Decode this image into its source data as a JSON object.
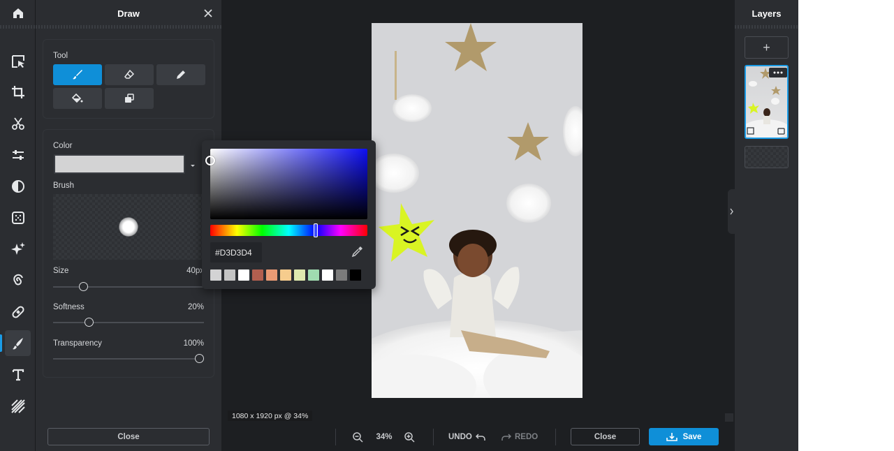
{
  "panel": {
    "title": "Draw",
    "close_label": "Close"
  },
  "tool": {
    "label": "Tool",
    "buttons": [
      {
        "name": "brush",
        "selected": true
      },
      {
        "name": "eraser"
      },
      {
        "name": "pencil"
      },
      {
        "name": "fill"
      },
      {
        "name": "clone"
      }
    ]
  },
  "color": {
    "label": "Color",
    "value": "#D3D3D4"
  },
  "brush": {
    "label": "Brush",
    "size": {
      "label": "Size",
      "value": "40px",
      "fraction": 0.18
    },
    "softness": {
      "label": "Softness",
      "value": "20%",
      "fraction": 0.22
    },
    "transparency": {
      "label": "Transparency",
      "value": "100%",
      "fraction": 1.0
    }
  },
  "picker": {
    "hex": "#D3D3D4",
    "swatches": [
      "#d3d3d4",
      "#c4c4c4",
      "#ffffff",
      "#b35f4f",
      "#eb9a74",
      "#f6cc8d",
      "#dfe9ae",
      "#a0dbb0",
      "#ffffff",
      "#7b7b7b",
      "#000000"
    ]
  },
  "canvas": {
    "info": "1080 x 1920 px @ 34%"
  },
  "bottom": {
    "zoom": "34%",
    "undo": "UNDO",
    "redo": "REDO",
    "close": "Close",
    "save": "Save"
  },
  "layers": {
    "title": "Layers",
    "add": "+"
  },
  "colors": {
    "accent": "#0f8fd8",
    "sticker": "#d9f423"
  }
}
